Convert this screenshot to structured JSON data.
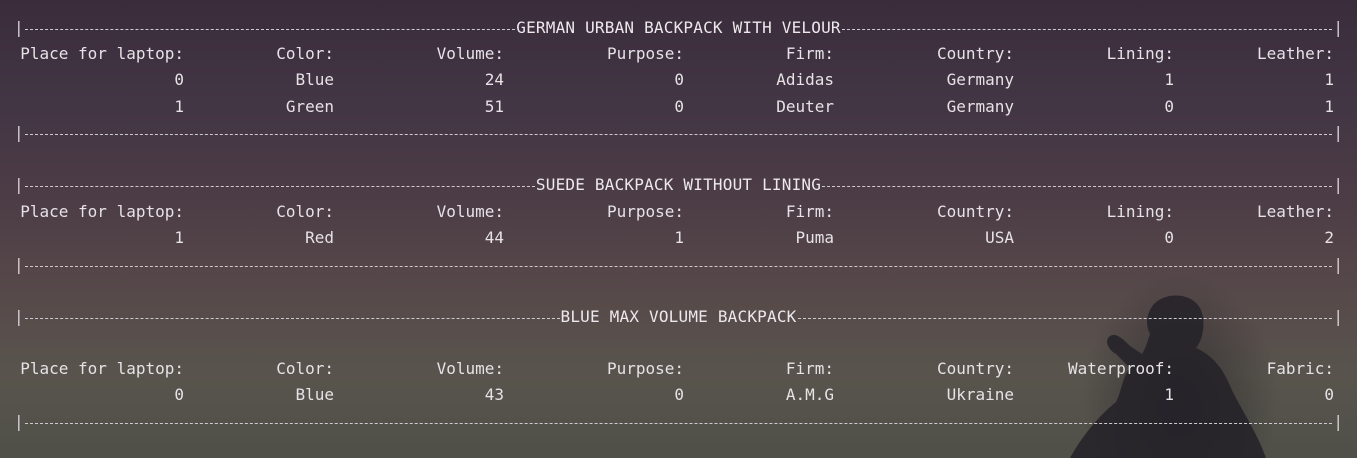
{
  "sections": [
    {
      "title": "GERMAN URBAN BACKPACK WITH VELOUR",
      "headers": [
        "Place for laptop:",
        "Color:",
        "Volume:",
        "Purpose:",
        "Firm:",
        "Country:",
        "Lining:",
        "Leather:"
      ],
      "rows": [
        [
          "0",
          "Blue",
          "24",
          "0",
          "Adidas",
          "Germany",
          "1",
          "1"
        ],
        [
          "1",
          "Green",
          "51",
          "0",
          "Deuter",
          "Germany",
          "0",
          "1"
        ]
      ]
    },
    {
      "title": "SUEDE BACKPACK WITHOUT LINING",
      "headers": [
        "Place for laptop:",
        "Color:",
        "Volume:",
        "Purpose:",
        "Firm:",
        "Country:",
        "Lining:",
        "Leather:"
      ],
      "rows": [
        [
          "1",
          "Red",
          "44",
          "1",
          "Puma",
          "USA",
          "0",
          "2"
        ]
      ]
    },
    {
      "title": "BLUE MAX VOLUME BACKPACK",
      "headers": [
        "Place for laptop:",
        "Color:",
        "Volume:",
        "Purpose:",
        "Firm:",
        "Country:",
        "Waterproof:",
        "Fabric:"
      ],
      "rows": [
        [
          "0",
          "Blue",
          "43",
          "0",
          "A.M.G",
          "Ukraine",
          "1",
          "0"
        ]
      ]
    }
  ],
  "border": {
    "corner": "|"
  }
}
